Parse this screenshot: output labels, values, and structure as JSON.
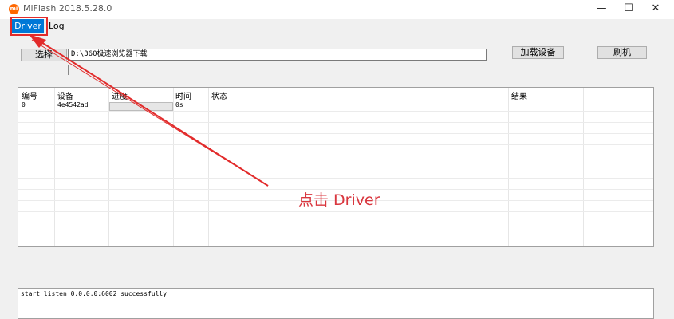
{
  "window": {
    "app_icon_text": "mi",
    "title": "MiFlash 2018.5.28.0",
    "minimize_glyph": "—",
    "maximize_glyph": "☐",
    "close_glyph": "✕"
  },
  "menu": {
    "driver": "Driver",
    "log": "Log"
  },
  "toolbar": {
    "select_label": "选择",
    "path_value": "D:\\360极速浏览器下载",
    "load_device_label": "加载设备",
    "flash_label": "刷机"
  },
  "table": {
    "headers": [
      "编号",
      "设备",
      "进度",
      "时间",
      "状态",
      "结果"
    ],
    "rows": [
      {
        "id": "0",
        "device": "4e4542ad",
        "progress": 0,
        "time": "0s",
        "status": "",
        "result": ""
      }
    ]
  },
  "log": {
    "text": "start listen 0.0.0.0:6002 successfully"
  },
  "annotation": {
    "text": "点击 Driver",
    "color": "#d9363e"
  },
  "colors": {
    "accent": "#0078d7",
    "annotation_red": "#e22b2b",
    "progress_green": "#06b025"
  }
}
